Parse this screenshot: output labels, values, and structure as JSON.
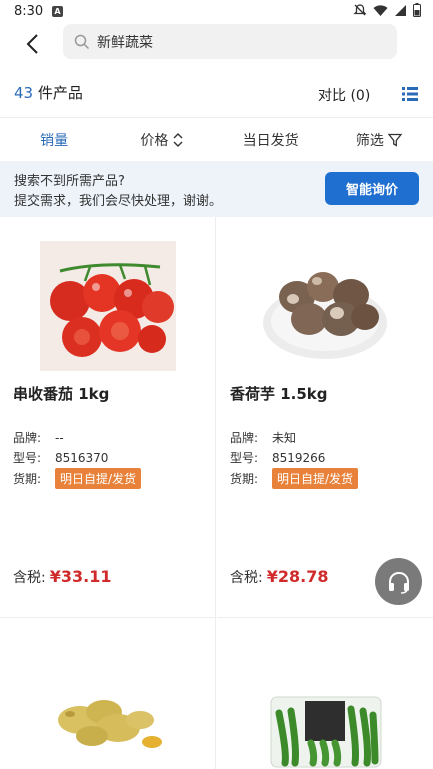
{
  "status": {
    "time": "8:30"
  },
  "header": {
    "search_value": "新鲜蔬菜"
  },
  "results": {
    "count": "43",
    "count_suffix": " 件产品",
    "compare_label": "对比 (0)"
  },
  "sort": {
    "items": [
      {
        "label": "销量"
      },
      {
        "label": "价格"
      },
      {
        "label": "当日发货"
      },
      {
        "label": "筛选"
      }
    ]
  },
  "notice": {
    "line1": "搜索不到所需产品?",
    "line2": "提交需求，我们会尽快处理，谢谢。",
    "button": "智能询价"
  },
  "labels": {
    "brand": "品牌:",
    "model": "型号:",
    "delivery": "货期:",
    "price_prefix": "含税:"
  },
  "products": [
    {
      "name": "串收番茄 1kg",
      "brand": "--",
      "model": "8516370",
      "delivery": "明日自提/发货",
      "price": "¥33.11",
      "image": "cherry-tomato-image"
    },
    {
      "name": "香荷芋 1.5kg",
      "brand": "未知",
      "model": "8519266",
      "delivery": "明日自提/发货",
      "price": "¥28.78",
      "image": "taro-image"
    },
    {
      "image": "ginger-image"
    },
    {
      "image": "okra-image"
    }
  ],
  "colors": {
    "accent_blue": "#2a6bb8",
    "button_blue": "#1f6fd1",
    "price_red": "#d02a2a",
    "badge_orange": "#e8823a"
  }
}
